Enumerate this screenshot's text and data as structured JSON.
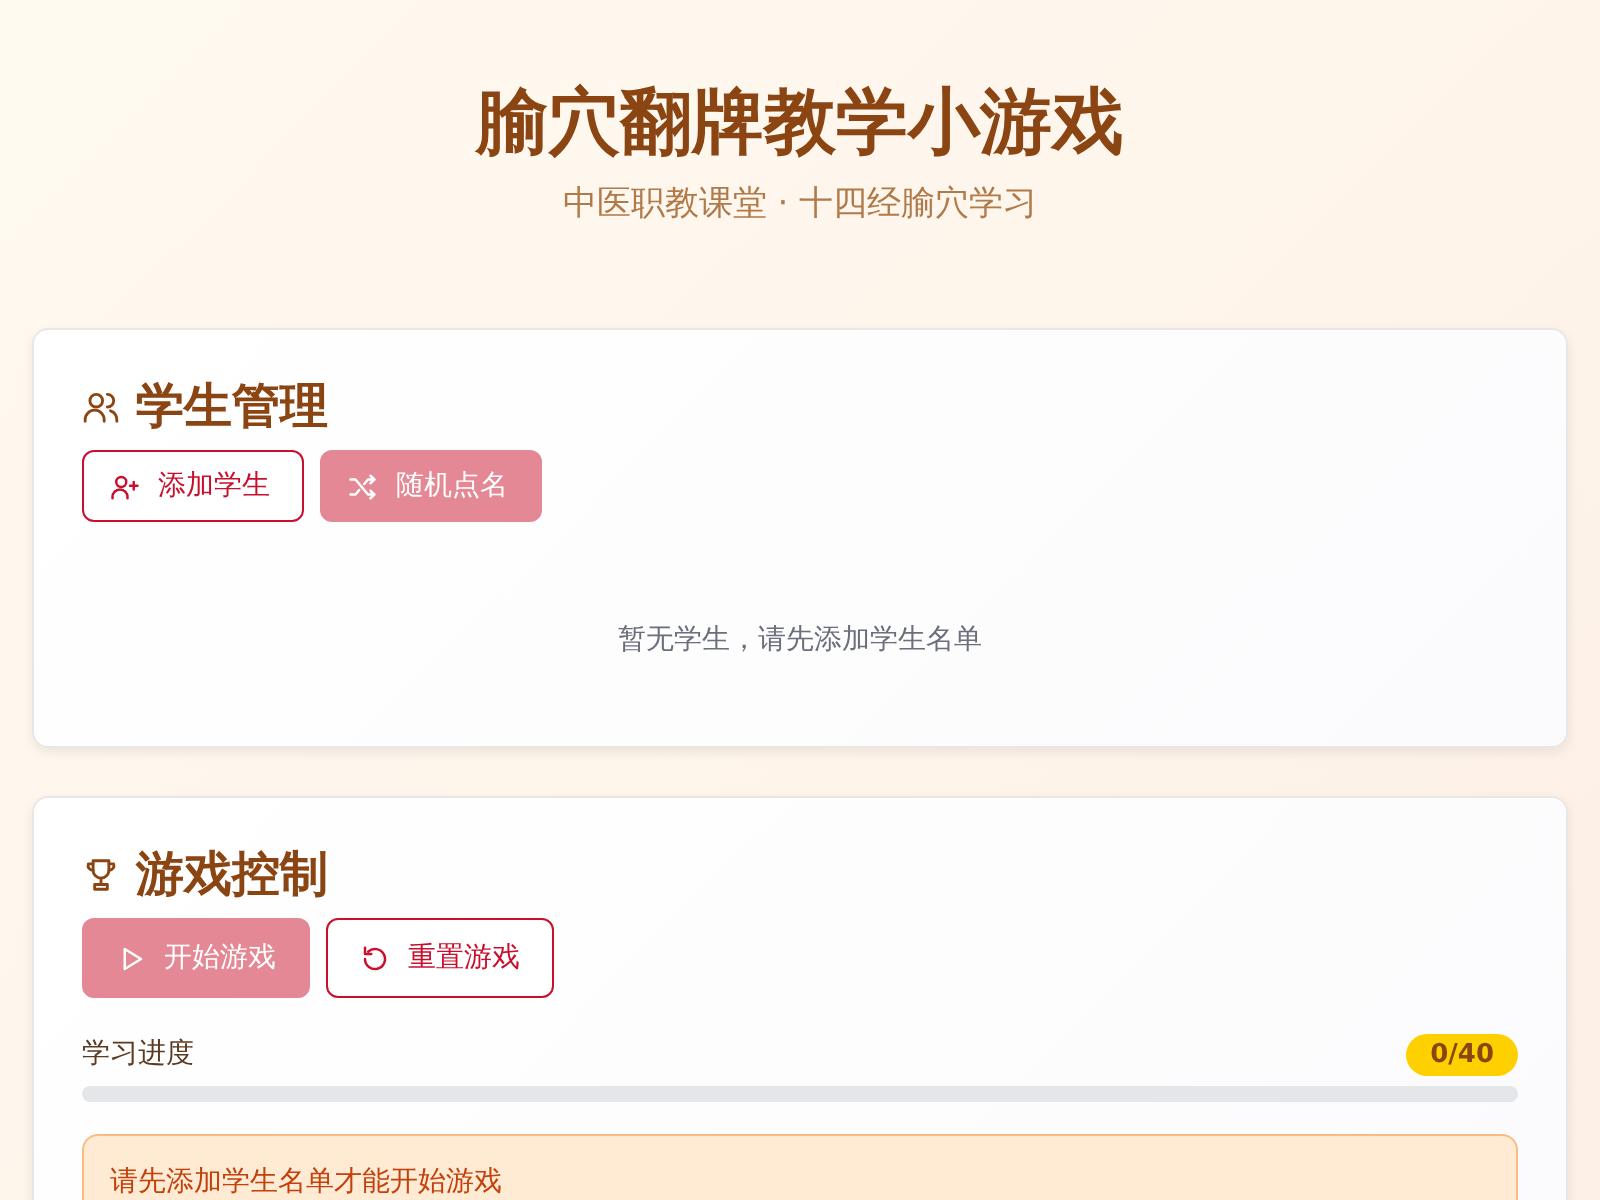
{
  "header": {
    "title": "腧穴翻牌教学小游戏",
    "subtitle": "中医职教课堂 · 十四经腧穴学习"
  },
  "student_panel": {
    "title": "学生管理",
    "buttons": [
      {
        "label": "添加学生",
        "kind": "outline",
        "disabled": false
      },
      {
        "label": "随机点名",
        "kind": "primary",
        "disabled": true
      }
    ],
    "empty_message": "暂无学生，请先添加学生名单"
  },
  "game_panel": {
    "title": "游戏控制",
    "buttons": [
      {
        "label": "开始游戏",
        "kind": "primary",
        "disabled": true
      },
      {
        "label": "重置游戏",
        "kind": "outline",
        "disabled": false
      }
    ],
    "progress": {
      "label": "学习进度",
      "count": "0/40",
      "level": 0
    },
    "alert": "请先添加学生名单才能开始游戏"
  }
}
